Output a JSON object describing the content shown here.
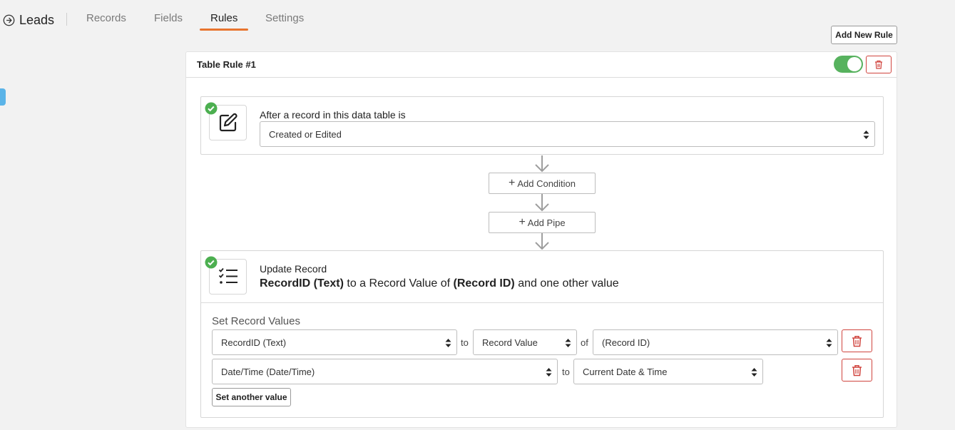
{
  "brand": {
    "name": "Leads",
    "icon": "plus-circle-icon"
  },
  "tabs": [
    {
      "label": "Records",
      "active": false
    },
    {
      "label": "Fields",
      "active": false
    },
    {
      "label": "Rules",
      "active": true
    },
    {
      "label": "Settings",
      "active": false
    }
  ],
  "toolbar": {
    "add_rule_label": "Add New Rule"
  },
  "rule": {
    "title": "Table Rule #1",
    "enabled": true,
    "trigger": {
      "icon": "edit-icon",
      "label": "After a record in this data table is",
      "selected": "Created or Edited"
    },
    "add_condition_label": "Add Condition",
    "add_pipe_label": "Add Pipe",
    "action": {
      "icon": "checklist-icon",
      "title": "Update Record",
      "summary": {
        "field": "RecordID (Text)",
        "text1": " to a Record Value of ",
        "value": "(Record ID)",
        "text2": " and one other value"
      },
      "set_values_label": "Set Record Values",
      "rows": [
        {
          "field": "RecordID (Text)",
          "to_word": "to",
          "type": "Record Value",
          "of_word": "of",
          "value": "(Record ID)"
        },
        {
          "field": "Date/Time (Date/Time)",
          "to_word": "to",
          "type": "Current Date & Time"
        }
      ],
      "set_another_label": "Set another value"
    }
  },
  "colors": {
    "accent": "#e8742e",
    "toggle_on": "#57b25e",
    "danger": "#d0443e",
    "check": "#4caf50",
    "handle": "#5bb4e8"
  }
}
